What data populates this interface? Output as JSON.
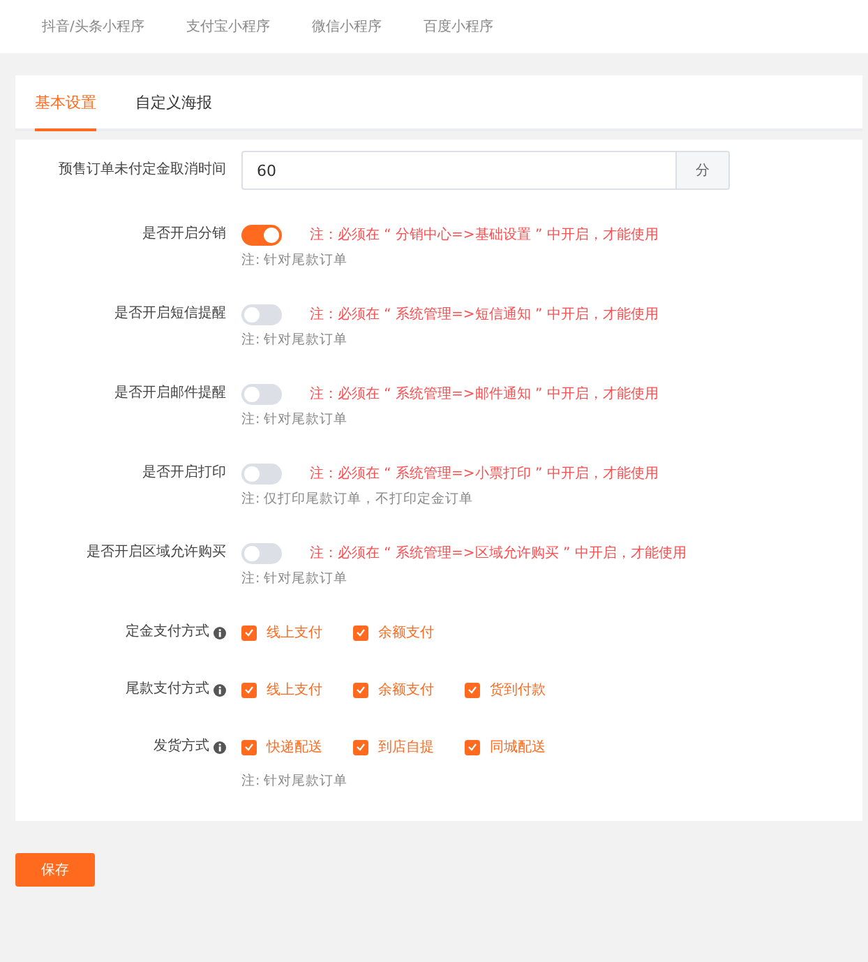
{
  "platform_tabs": [
    {
      "label": "抖音/头条小程序"
    },
    {
      "label": "支付宝小程序"
    },
    {
      "label": "微信小程序"
    },
    {
      "label": "百度小程序"
    }
  ],
  "tabs": [
    {
      "label": "基本设置",
      "selected": true
    },
    {
      "label": "自定义海报",
      "selected": false
    }
  ],
  "fields": [
    {
      "kind": "input",
      "label": "预售订单未付定金取消时间",
      "value": "60",
      "unit": "分"
    },
    {
      "kind": "switch",
      "label": "是否开启分销",
      "on": true,
      "warning": "注：必须在 “ 分销中心=>基础设置 ” 中开启，才能使用",
      "note": "注: 针对尾款订单"
    },
    {
      "kind": "switch",
      "label": "是否开启短信提醒",
      "on": false,
      "warning": "注：必须在 “ 系统管理=>短信通知 ” 中开启，才能使用",
      "note": "注: 针对尾款订单"
    },
    {
      "kind": "switch",
      "label": "是否开启邮件提醒",
      "on": false,
      "warning": "注：必须在 “ 系统管理=>邮件通知 ” 中开启，才能使用",
      "note": "注: 针对尾款订单"
    },
    {
      "kind": "switch",
      "label": "是否开启打印",
      "on": false,
      "warning": "注：必须在 “ 系统管理=>小票打印 ” 中开启，才能使用",
      "note": "注: 仅打印尾款订单，不打印定金订单"
    },
    {
      "kind": "switch",
      "label": "是否开启区域允许购买",
      "on": false,
      "warning": "注：必须在 “ 系统管理=>区域允许购买 ” 中开启，才能使用",
      "note": "注: 针对尾款订单"
    },
    {
      "kind": "checkboxes",
      "label": "定金支付方式",
      "info": true,
      "options": [
        {
          "label": "线上支付",
          "checked": true
        },
        {
          "label": "余额支付",
          "checked": true
        }
      ]
    },
    {
      "kind": "checkboxes",
      "label": "尾款支付方式",
      "info": true,
      "options": [
        {
          "label": "线上支付",
          "checked": true
        },
        {
          "label": "余额支付",
          "checked": true
        },
        {
          "label": "货到付款",
          "checked": true
        }
      ]
    },
    {
      "kind": "checkboxes",
      "label": "发货方式",
      "info": true,
      "options": [
        {
          "label": "快递配送",
          "checked": true
        },
        {
          "label": "到店自提",
          "checked": true
        },
        {
          "label": "同城配送",
          "checked": true
        }
      ],
      "note": "注: 针对尾款订单"
    }
  ],
  "save_button": "保存"
}
